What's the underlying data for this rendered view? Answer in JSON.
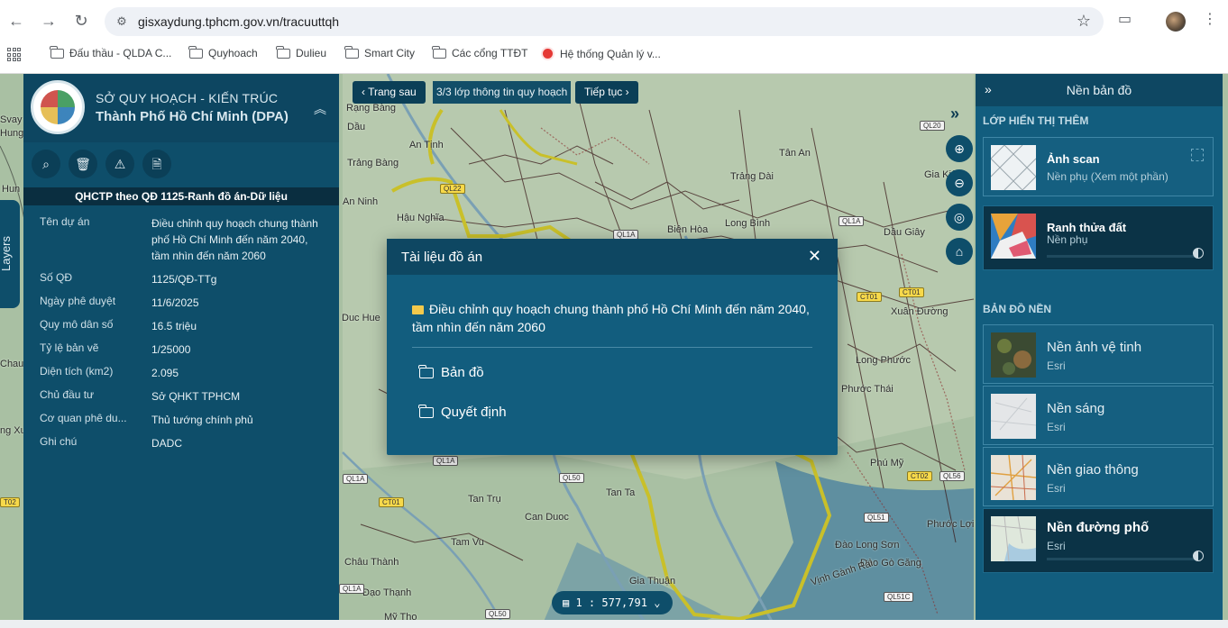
{
  "browser": {
    "url": "gisxaydung.tphcm.gov.vn/tracuuttqh",
    "bookmarks": [
      "Đấu thầu - QLDA C...",
      "Quyhoach",
      "Dulieu",
      "Smart City",
      "Các cổng TTĐT",
      "Hệ thống Quản lý v..."
    ]
  },
  "left_panel": {
    "org_line1": "SỞ QUY HOẠCH - KIẾN TRÚC",
    "org_line2": "Thành Phố Hồ Chí Minh (DPA)",
    "section_title": "QHCTP theo QĐ 1125-Ranh đồ án-Dữ liệu",
    "fields": [
      {
        "key": "Tên dự án",
        "value": "Điều chỉnh quy hoạch chung thành phố Hồ Chí Minh đến năm 2040, tầm nhìn đến năm 2060"
      },
      {
        "key": "Số QĐ",
        "value": "1125/QĐ-TTg"
      },
      {
        "key": "Ngày phê duyệt",
        "value": "11/6/2025"
      },
      {
        "key": "Quy mô dân số",
        "value": "16.5 triệu"
      },
      {
        "key": "Tỷ lệ bản vẽ",
        "value": "1/25000"
      },
      {
        "key": "Diện tích (km2)",
        "value": "2.095"
      },
      {
        "key": "Chủ đầu tư",
        "value": "Sở QHKT TPHCM"
      },
      {
        "key": "Cơ quan phê du...",
        "value": "Thủ tướng chính phủ"
      },
      {
        "key": "Ghi chú",
        "value": "DADC"
      }
    ],
    "layers_tab": "Layers"
  },
  "pager": {
    "prev": "‹ Trang sau",
    "status": "3/3 lớp thông tin quy hoạch",
    "next": "Tiếp tục ›"
  },
  "modal": {
    "title": "Tài liệu đồ án",
    "project": "Điều chỉnh quy hoạch chung thành phố Hồ Chí Minh đến năm 2040, tầm nhìn đến năm 2060",
    "items": [
      "Bản đồ",
      "Quyết định"
    ]
  },
  "scale": "1 : 577,791",
  "right_panel": {
    "title": "Nền bản đồ",
    "extra_section": "LỚP HIỂN THỊ THÊM",
    "extra_layers": [
      {
        "name": "Ảnh scan",
        "sub": "Nền phụ (Xem một phần)"
      },
      {
        "name": "Ranh thửa đất",
        "sub": "Nền phụ"
      }
    ],
    "base_section": "BẢN ĐỒ NỀN",
    "base_layers": [
      {
        "name": "Nền ảnh vệ tinh",
        "sub": "Esri"
      },
      {
        "name": "Nền sáng",
        "sub": "Esri"
      },
      {
        "name": "Nền giao thông",
        "sub": "Esri"
      },
      {
        "name": "Nền đường phố",
        "sub": "Esri"
      }
    ]
  },
  "map_labels": [
    "Svay",
    "Hun",
    "Chau",
    "Hung",
    "Rạng Bàng",
    "Dầu",
    "Trảng Bàng",
    "An Tịnh",
    "An Ninh",
    "Hậu Nghĩa",
    "Tân An",
    "Trảng Dài",
    "Long Bình",
    "Biên Hòa",
    "Dầu Giây",
    "Gia Kiệm",
    "Duc Hue",
    "Xuân Đường",
    "Long Phước",
    "Phước Thái",
    "Tan Trụ",
    "Tan Ta",
    "Can Duoc",
    "Tam Vu",
    "Châu Thành",
    "Đạo Thạnh",
    "Gia Thuận",
    "Phú Mỹ",
    "Đào Long Sơn",
    "Đào Gò Găng",
    "Phước Lợi",
    "Vịnh Gành Rái",
    "Mỹ Tho",
    "ng Xu"
  ],
  "road_shields": [
    "QL22",
    "QL1A",
    "QL20",
    "CT01",
    "CT01",
    "QL1A",
    "QL50",
    "CT01",
    "QL1A",
    "CT02",
    "QL56",
    "QL51",
    "QL1A",
    "QL50",
    "QL51C",
    "T02",
    "QL1A"
  ],
  "colors": {
    "panel": "#0e4e6a",
    "header": "#0e4762",
    "boundary": "#c9c02a"
  },
  "icons": {
    "tools": [
      "search-icon",
      "trash-icon",
      "warning-icon",
      "document-icon"
    ],
    "map_controls": [
      "zoom-in-icon",
      "zoom-out-icon",
      "locate-icon",
      "home-icon"
    ]
  }
}
